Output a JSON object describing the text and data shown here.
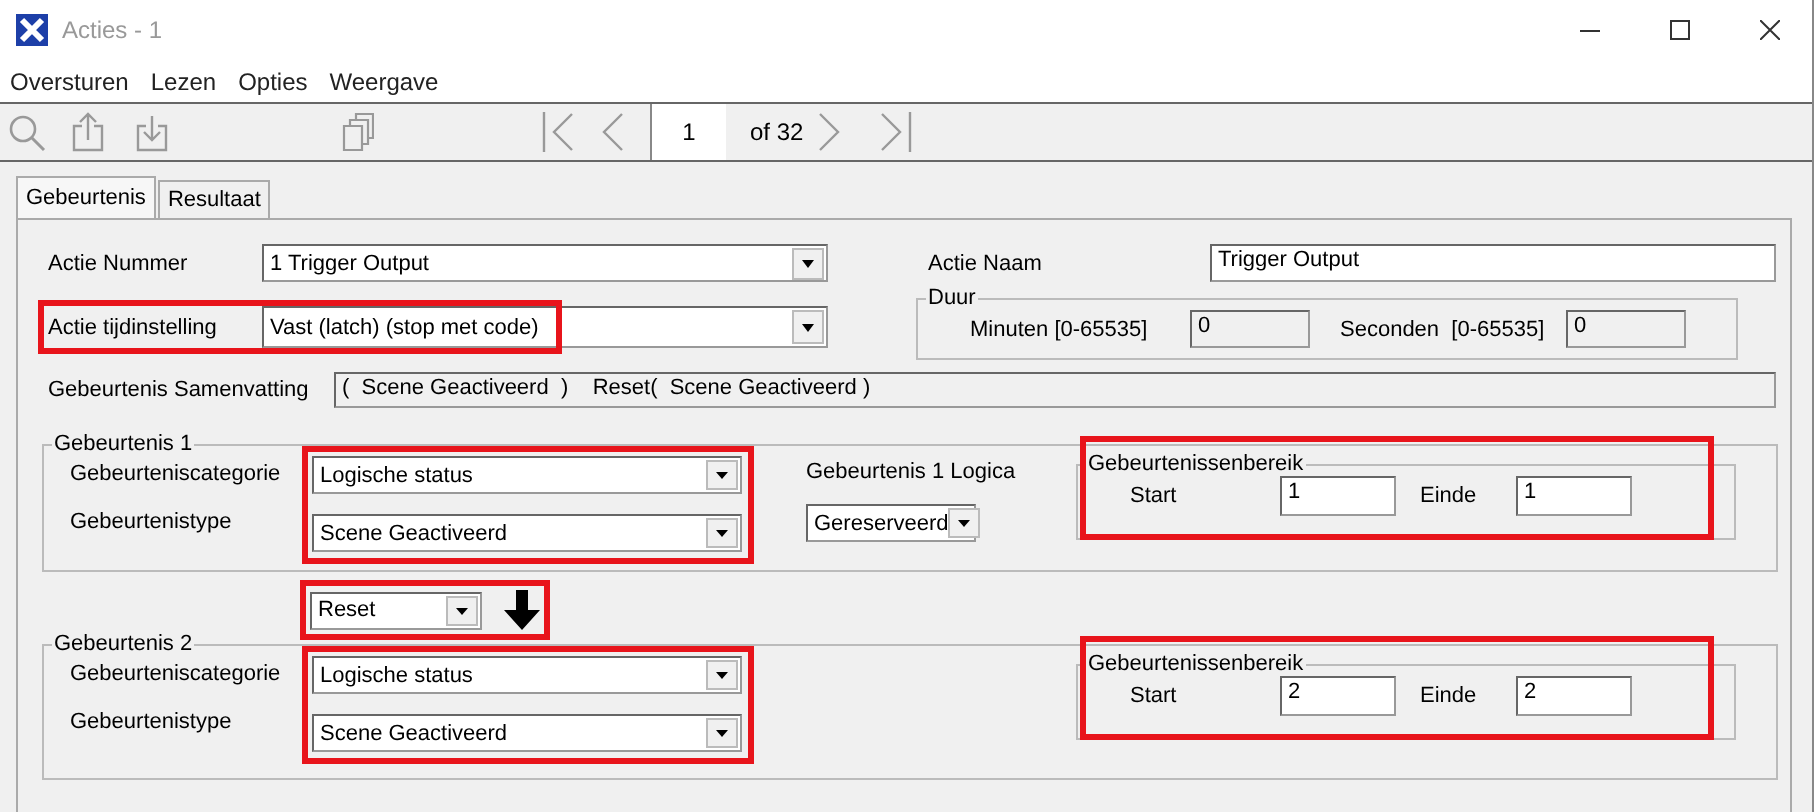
{
  "window": {
    "title": "Acties - 1"
  },
  "menu": [
    "Oversturen",
    "Lezen",
    "Opties",
    "Weergave"
  ],
  "toolbar": {
    "page": "1",
    "page_count": "of 32"
  },
  "tabs": [
    {
      "label": "Gebeurtenis",
      "selected": true
    },
    {
      "label": "Resultaat",
      "selected": false
    }
  ],
  "actie_nummer": {
    "label": "Actie Nummer",
    "value": "1 Trigger Output"
  },
  "actie_naam": {
    "label": "Actie Naam",
    "value": "Trigger Output"
  },
  "actie_tijdinstelling": {
    "label": "Actie tijdinstelling",
    "value": "Vast (latch) (stop met code)",
    "highlighted": true
  },
  "duur": {
    "legend": "Duur",
    "minuten_label": "Minuten [0-65535]",
    "minuten": "0",
    "seconden_label": "Seconden  [0-65535]",
    "seconden": "0",
    "disabled": true
  },
  "samenvatting": {
    "label": "Gebeurtenis Samenvatting",
    "value": "(  Scene Geactiveerd  )    Reset(  Scene Geactiveerd )"
  },
  "events": [
    {
      "legend": "Gebeurtenis 1",
      "category_label": "Gebeurteniscategorie",
      "category": "Logische status",
      "type_label": "Gebeurtenistype",
      "type": "Scene Geactiveerd",
      "highlighted": true,
      "logic_label": "Gebeurtenis 1 Logica",
      "logic": "Gereserveerd",
      "range": {
        "legend": "Gebeurtenissenbereik",
        "start_label": "Start",
        "start": "1",
        "end_label": "Einde",
        "end": "1",
        "highlighted": true
      }
    },
    {
      "legend": "Gebeurtenis 2",
      "category_label": "Gebeurteniscategorie",
      "category": "Logische status",
      "type_label": "Gebeurtenistype",
      "type": "Scene Geactiveerd",
      "highlighted": true,
      "range": {
        "legend": "Gebeurtenissenbereik",
        "start_label": "Start",
        "start": "2",
        "end_label": "Einde",
        "end": "2",
        "highlighted": true
      }
    }
  ],
  "operator": {
    "value": "Reset",
    "highlighted": true
  }
}
